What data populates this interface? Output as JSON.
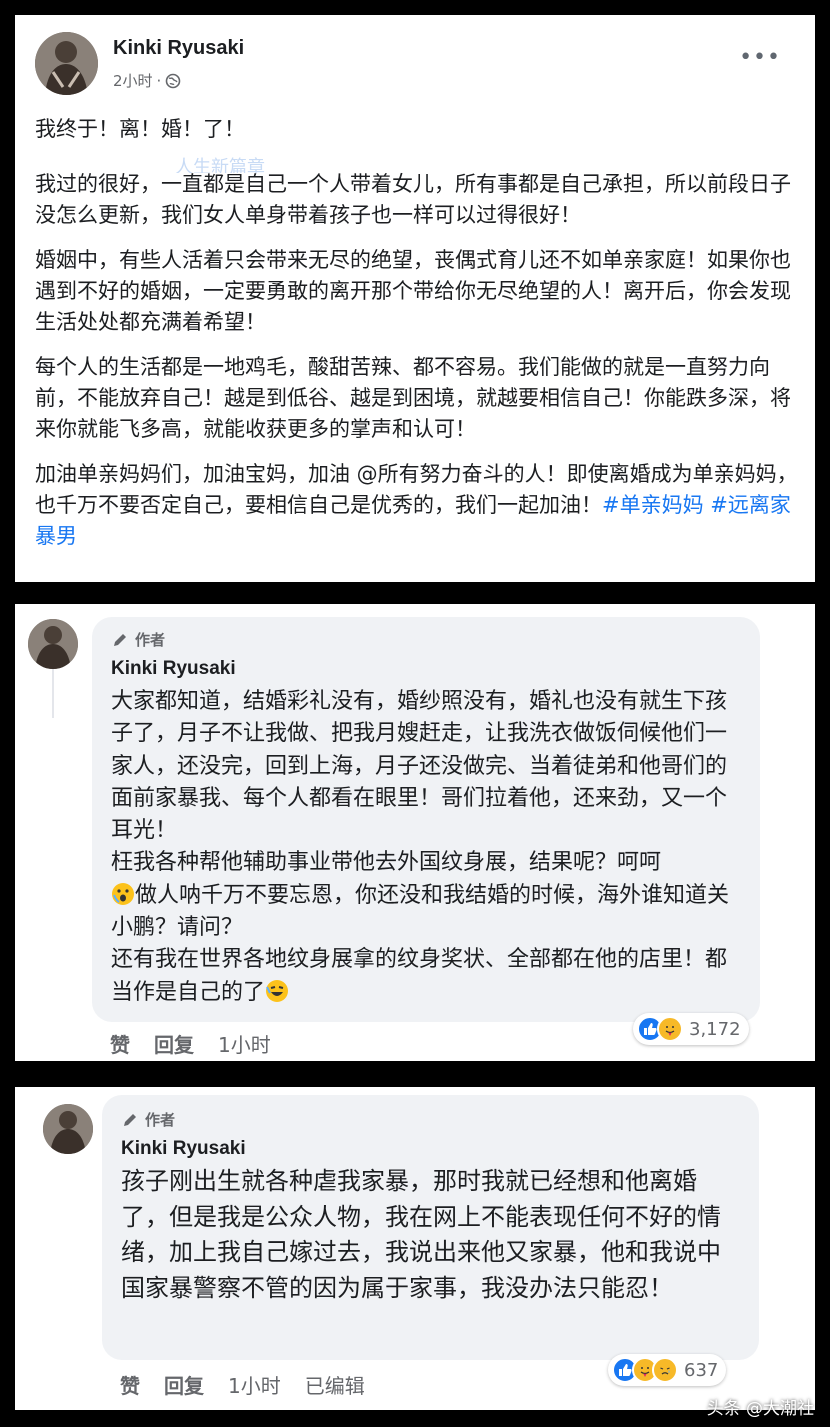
{
  "post": {
    "author": "Kinki Ryusaki",
    "time": "2小时",
    "headline": "我终于！离！婚！了！",
    "faded_line": "人生新篇章",
    "paragraphs": [
      "我过的很好，一直都是自己一个人带着女儿，所有事都是自己承担，所以前段日子没怎么更新，我们女人单身带着孩子也一样可以过得很好！",
      "婚姻中，有些人活着只会带来无尽的绝望，丧偶式育儿还不如单亲家庭！如果你也遇到不好的婚姻，一定要勇敢的离开那个带给你无尽绝望的人！离开后，你会发现生活处处都充满着希望！",
      "每个人的生活都是一地鸡毛，酸甜苦辣、都不容易。我们能做的就是一直努力向前，不能放弃自己！越是到低谷、越是到困境，就越要相信自己！你能跌多深，将来你就能飞多高，就能收获更多的掌声和认可！"
    ],
    "last_paragraph": "加油单亲妈妈们，加油宝妈，加油 @所有努力奋斗的人！即使离婚成为单亲妈妈，也千万不要否定自己，要相信自己是优秀的，我们一起加油！",
    "hashtag_1": "#单亲妈妈",
    "hashtag_2": "#远离家暴男"
  },
  "comment_1": {
    "author_tag": "作者",
    "author": "Kinki Ryusaki",
    "part_1": "大家都知道，结婚彩礼没有，婚纱照没有，婚礼也没有就生下孩子了，月子不让我做、把我月嫂赶走，让我洗衣做饭伺候他们一家人，还没完，回到上海，月子还没做完、当着徒弟和他哥们的面前家暴我、每个人都看在眼里！哥们拉着他，还来劲，又一个耳光！",
    "part_2": "枉我各种帮他辅助事业带他去外国纹身展，结果呢？呵呵",
    "part_3": "做人呐千万不要忘恩，你还没和我结婚的时候，海外谁知道关小鹏？请问？",
    "part_4": "还有我在世界各地纹身展拿的纹身奖状、全部都在他的店里！都当作是自己的了",
    "like": "赞",
    "reply": "回复",
    "time": "1小时",
    "reaction_count": "3,172"
  },
  "comment_2": {
    "author_tag": "作者",
    "author": "Kinki Ryusaki",
    "text": "孩子刚出生就各种虐我家暴，那时我就已经想和他离婚了，但是我是公众人物，我在网上不能表现任何不好的情绪，加上我自己嫁过去，我说出来他又家暴，他和我说中国家暴警察不管的因为属于家事，我没办法只能忍！",
    "like": "赞",
    "reply": "回复",
    "time": "1小时",
    "edited": "已编辑",
    "reaction_count": "637"
  },
  "watermark": "头条 @大潮社",
  "colors": {
    "hashtag": "#1877f2",
    "bubble": "#f0f2f5",
    "meta": "#65676b"
  }
}
